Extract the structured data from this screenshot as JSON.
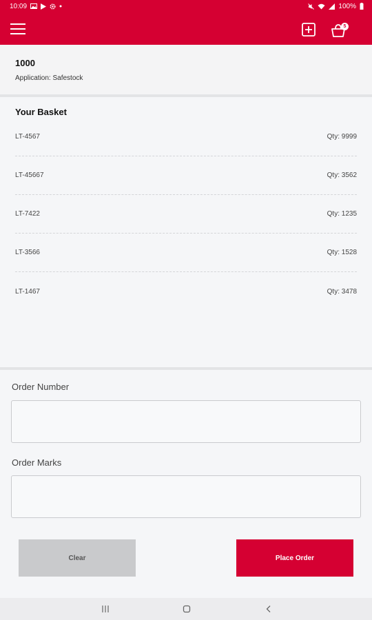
{
  "status_bar": {
    "time": "10:09",
    "left_icons": [
      "gallery-icon",
      "play-store-icon",
      "settings-icon",
      "dot-icon"
    ],
    "battery": "100%",
    "right_icons": [
      "mute-icon",
      "wifi-icon",
      "signal-icon",
      "battery-icon"
    ]
  },
  "app_bar": {
    "background_color": "#d50032",
    "icons": [
      "menu-icon",
      "add-box-icon",
      "cart-icon"
    ],
    "cart_badge": "5"
  },
  "header": {
    "title": "1000",
    "subtitle": "Application: Safestock"
  },
  "basket": {
    "title": "Your Basket",
    "items": [
      {
        "code": "LT-4567",
        "qty": "Qty: 9999"
      },
      {
        "code": "LT-45667",
        "qty": "Qty: 3562"
      },
      {
        "code": "LT-7422",
        "qty": "Qty: 1235"
      },
      {
        "code": "LT-3566",
        "qty": "Qty: 1528"
      },
      {
        "code": "LT-1467",
        "qty": "Qty: 3478"
      }
    ]
  },
  "form": {
    "order_number_label": "Order Number",
    "order_number_value": "",
    "order_marks_label": "Order Marks",
    "order_marks_value": ""
  },
  "buttons": {
    "clear": "Clear",
    "place_order": "Place Order"
  },
  "nav_bar": {
    "icons": [
      "recents-icon",
      "home-icon",
      "back-icon"
    ]
  }
}
